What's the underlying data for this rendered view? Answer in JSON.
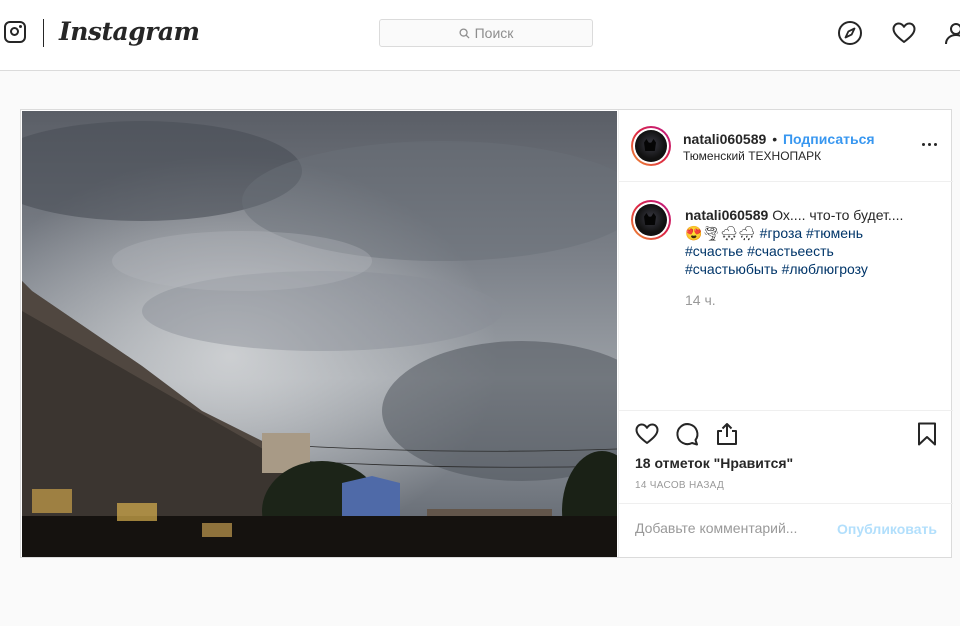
{
  "header": {
    "brand": "Instagram",
    "search_placeholder": "Поиск",
    "icons": [
      "instagram-glyph-icon",
      "search-icon",
      "explore-compass-icon",
      "activity-heart-icon",
      "profile-icon"
    ]
  },
  "post": {
    "author": {
      "username": "natali060589",
      "separator": "•",
      "follow_label": "Подписаться",
      "location": "Тюменский ТЕХНОПАРК"
    },
    "caption": {
      "username": "natali060589",
      "text": "Ох.... что-то будет....",
      "emojis": "😍🌪🌨🌧",
      "hashtags_line1": "#гроза #тюмень",
      "hashtags_line2": "#счастье #счастьеесть",
      "hashtags_line3": "#счастьюбыть #люблюгрозу",
      "time": "14 ч."
    },
    "likes_text": "18 отметок \"Нравится\"",
    "time_ago": "14 ЧАСОВ НАЗАД",
    "comment_placeholder": "Добавьте комментарий...",
    "publish_label": "Опубликовать"
  },
  "colors": {
    "link_blue": "#3897f0",
    "hashtag_blue": "#003569",
    "publish_disabled": "#b2dffc",
    "border": "#dbdbdb"
  }
}
